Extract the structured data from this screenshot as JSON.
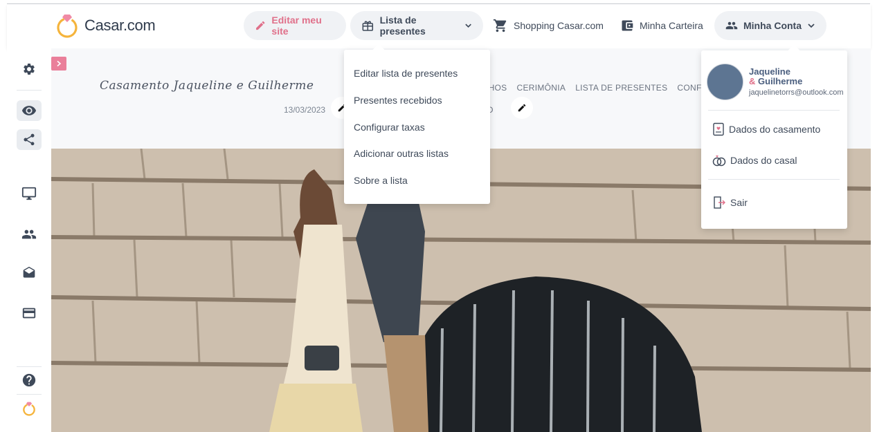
{
  "brand": {
    "name": "Casar.com",
    "accent": "#e0708a",
    "ring_color": "#f5b43c"
  },
  "topnav": {
    "edit_site": "Editar meu site",
    "gift_list": "Lista de presentes",
    "shopping": "Shopping Casar.com",
    "wallet": "Minha Carteira",
    "account": "Minha Conta"
  },
  "gift_menu": {
    "items": [
      {
        "label": "Editar lista de presentes"
      },
      {
        "label": "Presentes recebidos"
      },
      {
        "label": "Configurar taxas"
      },
      {
        "label": "Adicionar outras listas"
      },
      {
        "label": "Sobre a lista"
      }
    ]
  },
  "account_menu": {
    "name_line1": "Jaqueline",
    "amp": "&",
    "name_line2": "Guilherme",
    "email": "jaquelinetorrs@outlook.com",
    "items": [
      {
        "label": "Dados do casamento",
        "icon": "document-heart-icon"
      },
      {
        "label": "Dados do casal",
        "icon": "rings-icon"
      },
      {
        "label": "Sair",
        "icon": "logout-icon"
      }
    ]
  },
  "site_header": {
    "couple_title": "Casamento Jaqueline e Guilherme",
    "date": "13/03/2023",
    "menu": [
      "RINHOS",
      "CERIMÔNIA",
      "LISTA DE PRESENTES",
      "CONFI"
    ],
    "menu_second_row": "TO"
  },
  "sidebar": {
    "icons": [
      "gear-icon",
      "eye-icon",
      "share-icon",
      "monitor-icon",
      "people-icon",
      "mail-open-icon",
      "card-icon",
      "help-icon",
      "ring-logo-icon"
    ]
  }
}
